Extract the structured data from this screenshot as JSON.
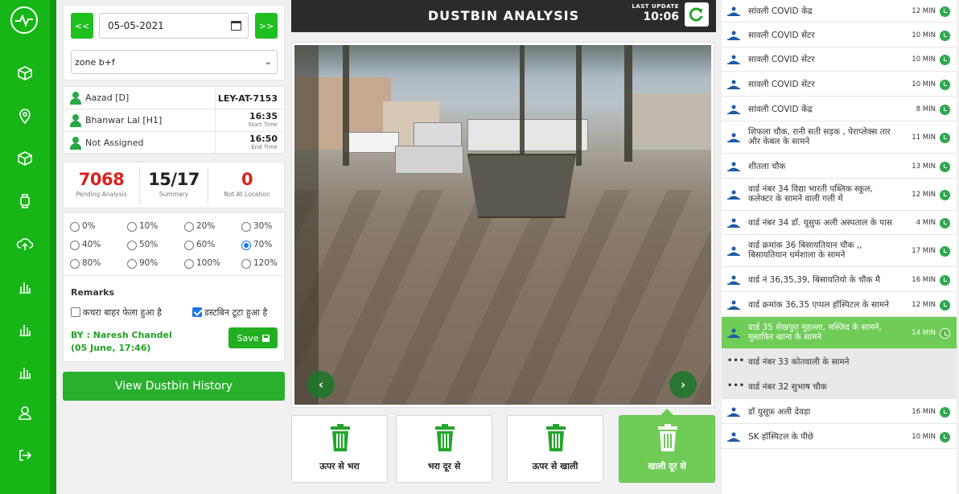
{
  "sidebar": {
    "items": [
      {
        "icon": "box-icon"
      },
      {
        "icon": "location-pin-icon"
      },
      {
        "icon": "box-icon"
      },
      {
        "icon": "watch-icon"
      },
      {
        "icon": "cloud-upload-icon"
      },
      {
        "icon": "bar-chart-icon"
      },
      {
        "icon": "bar-chart-icon"
      },
      {
        "icon": "bar-chart-icon"
      },
      {
        "icon": "user-icon"
      },
      {
        "icon": "logout-icon"
      }
    ]
  },
  "filters": {
    "prev_label": "<<",
    "next_label": ">>",
    "date": "05-05-2021",
    "zone": "zone b+f"
  },
  "staff": {
    "rows": [
      {
        "name": "Aazad [D]",
        "value": "LEY-AT-7153",
        "caption": ""
      },
      {
        "name": "Bhanwar Lal [H1]",
        "value": "16:35",
        "caption": "Start Time"
      },
      {
        "name": "Not Assigned",
        "value": "16:50",
        "caption": "End Time"
      }
    ]
  },
  "stats": {
    "pending": {
      "value": "7068",
      "label": "Pending Analysis",
      "color": "#d9231d"
    },
    "summary": {
      "value": "15/17",
      "label": "Summary",
      "color": "#222222"
    },
    "not_at_location": {
      "value": "0",
      "label": "Not At Location",
      "color": "#d9231d"
    }
  },
  "percent_options": [
    "0%",
    "10%",
    "20%",
    "30%",
    "40%",
    "50%",
    "60%",
    "70%",
    "80%",
    "90%",
    "100%",
    "120%"
  ],
  "percent_selected": "70%",
  "remarks": {
    "title": "Remarks",
    "options": [
      {
        "label": "कचरा बाहर फेला हुआ है",
        "checked": false
      },
      {
        "label": "डस्टबिन टूटा हुआ है",
        "checked": true
      }
    ],
    "by_line1": "BY : Naresh Chandel",
    "by_line2": "(05 June, 17:46)",
    "save_label": "Save"
  },
  "history_label": "View Dustbin History",
  "header": {
    "title": "DUSTBIN ANALYSIS",
    "last_update_label": "LAST UPDATE",
    "last_update_time": "10:06"
  },
  "status_tiles": [
    {
      "label": "ऊपर से भरा",
      "active": false
    },
    {
      "label": "भरा दूर से",
      "active": false
    },
    {
      "label": "ऊपर से खाली",
      "active": false
    },
    {
      "label": "खाली दूर से",
      "active": true
    }
  ],
  "locations": [
    {
      "text": "सांवली COVID केंद्र",
      "time": "12 MIN",
      "state": "normal"
    },
    {
      "text": "सावली COVID सेंटर",
      "time": "10 MIN",
      "state": "normal"
    },
    {
      "text": "सावली COVID सेंटर",
      "time": "10 MIN",
      "state": "normal"
    },
    {
      "text": "सावली COVID सेंटर",
      "time": "10 MIN",
      "state": "normal"
    },
    {
      "text": "सांवली COVID केंद्र",
      "time": "8 MIN",
      "state": "normal"
    },
    {
      "text": "शिफला चौक, रानी सती सड़क , पेराप्लेक्स तार और केबल के सामने",
      "time": "11 MIN",
      "state": "normal"
    },
    {
      "text": "शीतला चौक",
      "time": "13 MIN",
      "state": "normal"
    },
    {
      "text": "वार्ड नंबर 34 विद्या भारती पब्लिक स्कूल, कलेक्टर के सामने वाली गली में",
      "time": "12 MIN",
      "state": "normal"
    },
    {
      "text": "वार्ड नंबर 34 डॉ. यूसुफ अली अस्पताल के पास",
      "time": "4 MIN",
      "state": "normal"
    },
    {
      "text": "वार्ड क्रमांक 36 बिसायतियान चौक ,, बिसायतियान धर्मशाला के सामने",
      "time": "17 MIN",
      "state": "normal"
    },
    {
      "text": "वार्ड नं 36,35,39, बिसायतियो के चौक मै",
      "time": "16 MIN",
      "state": "normal"
    },
    {
      "text": "वार्ड क्रमांक 36,35 एप्पल हॉस्पिटल के सामने",
      "time": "12 MIN",
      "state": "normal"
    },
    {
      "text": "वार्ड 35 शेखपुरा मुहल्ला, मस्जिद के सामने, मुसाफिर खाना के सामने",
      "time": "14 MIN",
      "state": "active"
    },
    {
      "text": "वार्ड नंबर 33 कोतवाली के सामने",
      "time": "",
      "state": "pending"
    },
    {
      "text": "वार्ड नंबर 32 सुभाष चौक",
      "time": "",
      "state": "pending"
    },
    {
      "text": "डॉ युसूफ़ अली देवड़ा",
      "time": "16 MIN",
      "state": "normal"
    },
    {
      "text": "SK हॉस्पिटल के पीछे",
      "time": "10 MIN",
      "state": "normal"
    }
  ]
}
